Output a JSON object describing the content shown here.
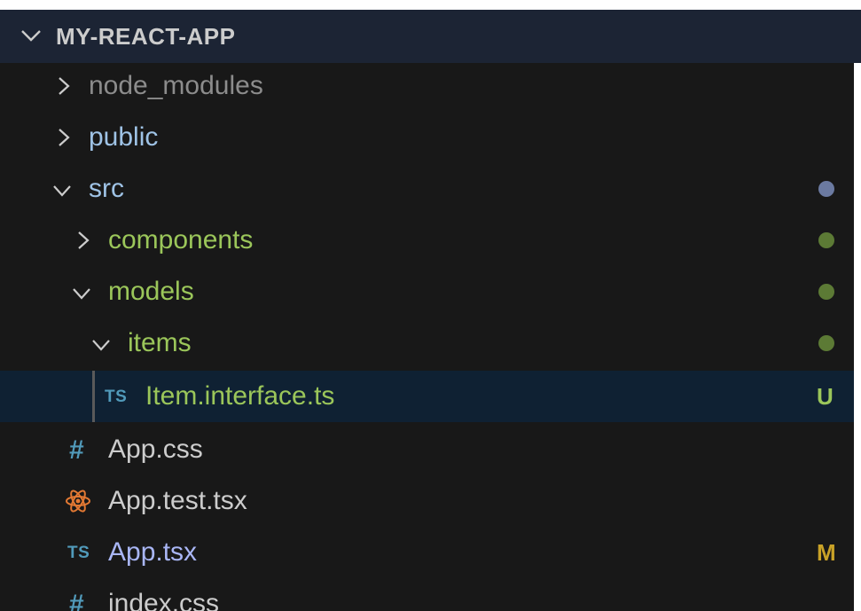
{
  "explorer": {
    "title": "MY-REACT-APP",
    "items": [
      {
        "label": "node_modules",
        "color": "#8c8c8c"
      },
      {
        "label": "public",
        "color": "#9fc3e6"
      },
      {
        "label": "src",
        "color": "#9fc3e6",
        "dot": "#6b7aa1"
      },
      {
        "label": "components",
        "color": "#9bc65a",
        "dot": "#5c7a35"
      },
      {
        "label": "models",
        "color": "#9bc65a",
        "dot": "#5c7a35"
      },
      {
        "label": "items",
        "color": "#9bc65a",
        "dot": "#5c7a35"
      },
      {
        "label": "Item.interface.ts",
        "icon": "TS",
        "color": "#9bc65a",
        "status": "U"
      },
      {
        "label": "App.css",
        "icon": "#",
        "color": "#cccccc"
      },
      {
        "label": "App.test.tsx",
        "color": "#cccccc"
      },
      {
        "label": "App.tsx",
        "icon": "TS",
        "color": "#a9b6f5",
        "status": "M"
      },
      {
        "label": "index.css",
        "icon": "#",
        "color": "#cccccc"
      }
    ]
  }
}
